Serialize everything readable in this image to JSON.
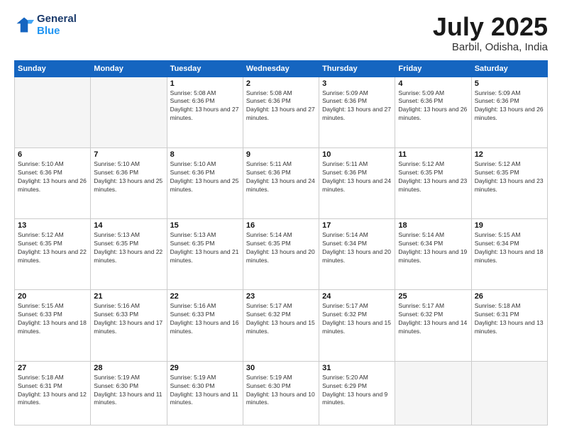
{
  "header": {
    "logo_line1": "General",
    "logo_line2": "Blue",
    "month": "July 2025",
    "location": "Barbil, Odisha, India"
  },
  "weekdays": [
    "Sunday",
    "Monday",
    "Tuesday",
    "Wednesday",
    "Thursday",
    "Friday",
    "Saturday"
  ],
  "weeks": [
    [
      {
        "day": "",
        "info": ""
      },
      {
        "day": "",
        "info": ""
      },
      {
        "day": "1",
        "info": "Sunrise: 5:08 AM\nSunset: 6:36 PM\nDaylight: 13 hours and 27 minutes."
      },
      {
        "day": "2",
        "info": "Sunrise: 5:08 AM\nSunset: 6:36 PM\nDaylight: 13 hours and 27 minutes."
      },
      {
        "day": "3",
        "info": "Sunrise: 5:09 AM\nSunset: 6:36 PM\nDaylight: 13 hours and 27 minutes."
      },
      {
        "day": "4",
        "info": "Sunrise: 5:09 AM\nSunset: 6:36 PM\nDaylight: 13 hours and 26 minutes."
      },
      {
        "day": "5",
        "info": "Sunrise: 5:09 AM\nSunset: 6:36 PM\nDaylight: 13 hours and 26 minutes."
      }
    ],
    [
      {
        "day": "6",
        "info": "Sunrise: 5:10 AM\nSunset: 6:36 PM\nDaylight: 13 hours and 26 minutes."
      },
      {
        "day": "7",
        "info": "Sunrise: 5:10 AM\nSunset: 6:36 PM\nDaylight: 13 hours and 25 minutes."
      },
      {
        "day": "8",
        "info": "Sunrise: 5:10 AM\nSunset: 6:36 PM\nDaylight: 13 hours and 25 minutes."
      },
      {
        "day": "9",
        "info": "Sunrise: 5:11 AM\nSunset: 6:36 PM\nDaylight: 13 hours and 24 minutes."
      },
      {
        "day": "10",
        "info": "Sunrise: 5:11 AM\nSunset: 6:36 PM\nDaylight: 13 hours and 24 minutes."
      },
      {
        "day": "11",
        "info": "Sunrise: 5:12 AM\nSunset: 6:35 PM\nDaylight: 13 hours and 23 minutes."
      },
      {
        "day": "12",
        "info": "Sunrise: 5:12 AM\nSunset: 6:35 PM\nDaylight: 13 hours and 23 minutes."
      }
    ],
    [
      {
        "day": "13",
        "info": "Sunrise: 5:12 AM\nSunset: 6:35 PM\nDaylight: 13 hours and 22 minutes."
      },
      {
        "day": "14",
        "info": "Sunrise: 5:13 AM\nSunset: 6:35 PM\nDaylight: 13 hours and 22 minutes."
      },
      {
        "day": "15",
        "info": "Sunrise: 5:13 AM\nSunset: 6:35 PM\nDaylight: 13 hours and 21 minutes."
      },
      {
        "day": "16",
        "info": "Sunrise: 5:14 AM\nSunset: 6:35 PM\nDaylight: 13 hours and 20 minutes."
      },
      {
        "day": "17",
        "info": "Sunrise: 5:14 AM\nSunset: 6:34 PM\nDaylight: 13 hours and 20 minutes."
      },
      {
        "day": "18",
        "info": "Sunrise: 5:14 AM\nSunset: 6:34 PM\nDaylight: 13 hours and 19 minutes."
      },
      {
        "day": "19",
        "info": "Sunrise: 5:15 AM\nSunset: 6:34 PM\nDaylight: 13 hours and 18 minutes."
      }
    ],
    [
      {
        "day": "20",
        "info": "Sunrise: 5:15 AM\nSunset: 6:33 PM\nDaylight: 13 hours and 18 minutes."
      },
      {
        "day": "21",
        "info": "Sunrise: 5:16 AM\nSunset: 6:33 PM\nDaylight: 13 hours and 17 minutes."
      },
      {
        "day": "22",
        "info": "Sunrise: 5:16 AM\nSunset: 6:33 PM\nDaylight: 13 hours and 16 minutes."
      },
      {
        "day": "23",
        "info": "Sunrise: 5:17 AM\nSunset: 6:32 PM\nDaylight: 13 hours and 15 minutes."
      },
      {
        "day": "24",
        "info": "Sunrise: 5:17 AM\nSunset: 6:32 PM\nDaylight: 13 hours and 15 minutes."
      },
      {
        "day": "25",
        "info": "Sunrise: 5:17 AM\nSunset: 6:32 PM\nDaylight: 13 hours and 14 minutes."
      },
      {
        "day": "26",
        "info": "Sunrise: 5:18 AM\nSunset: 6:31 PM\nDaylight: 13 hours and 13 minutes."
      }
    ],
    [
      {
        "day": "27",
        "info": "Sunrise: 5:18 AM\nSunset: 6:31 PM\nDaylight: 13 hours and 12 minutes."
      },
      {
        "day": "28",
        "info": "Sunrise: 5:19 AM\nSunset: 6:30 PM\nDaylight: 13 hours and 11 minutes."
      },
      {
        "day": "29",
        "info": "Sunrise: 5:19 AM\nSunset: 6:30 PM\nDaylight: 13 hours and 11 minutes."
      },
      {
        "day": "30",
        "info": "Sunrise: 5:19 AM\nSunset: 6:30 PM\nDaylight: 13 hours and 10 minutes."
      },
      {
        "day": "31",
        "info": "Sunrise: 5:20 AM\nSunset: 6:29 PM\nDaylight: 13 hours and 9 minutes."
      },
      {
        "day": "",
        "info": ""
      },
      {
        "day": "",
        "info": ""
      }
    ]
  ]
}
